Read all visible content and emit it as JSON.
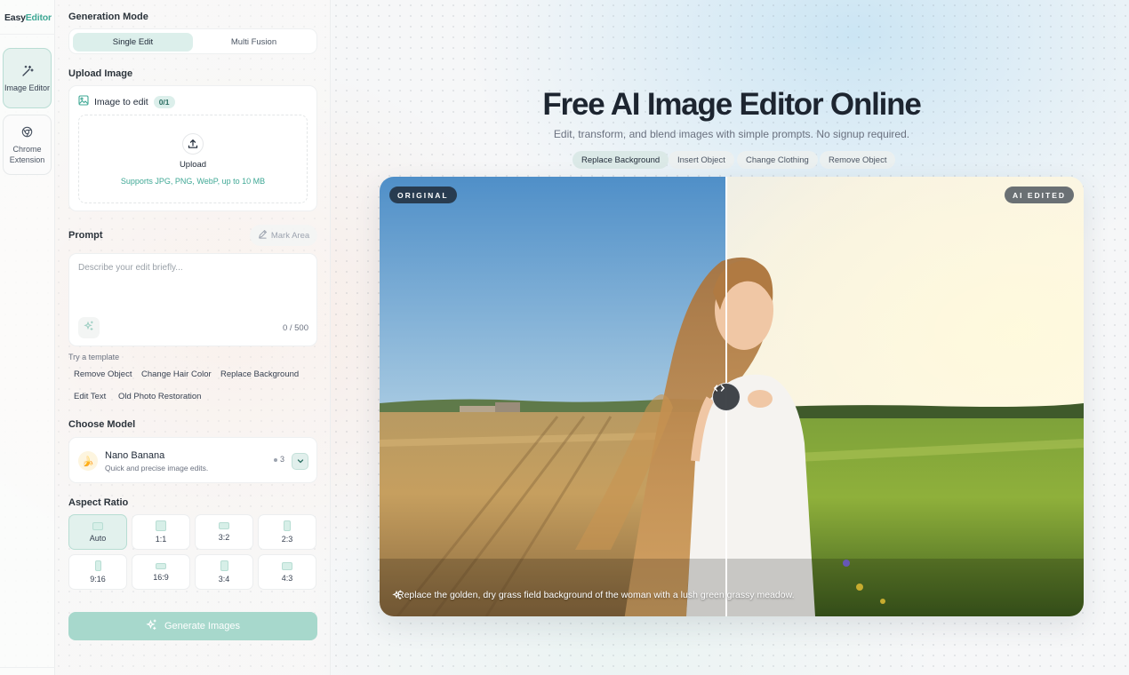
{
  "app": {
    "logo_main": "Easy",
    "logo_accent": "Editor"
  },
  "rail": {
    "items": [
      {
        "label": "Image Editor",
        "icon": "magic-wand-icon",
        "active": true
      },
      {
        "label": "Chrome Extension",
        "icon": "chrome-icon",
        "active": false
      }
    ]
  },
  "panel": {
    "generation_mode": {
      "title": "Generation Mode",
      "options": [
        "Single Edit",
        "Multi Fusion"
      ],
      "selected": "Single Edit"
    },
    "upload": {
      "title": "Upload Image",
      "field_label": "Image to edit",
      "count": "0/1",
      "button_label": "Upload",
      "hint": "Supports JPG, PNG, WebP, up to 10 MB"
    },
    "prompt": {
      "title": "Prompt",
      "mark_area_label": "Mark Area",
      "placeholder": "Describe your edit briefly...",
      "value": "",
      "counter": "0 / 500"
    },
    "templates": {
      "label": "Try a template",
      "items": [
        "Remove Object",
        "Change Hair Color",
        "Replace Background",
        "Edit Text",
        "Old Photo Restoration"
      ]
    },
    "model": {
      "title": "Choose Model",
      "name": "Nano Banana",
      "description": "Quick and precise image edits.",
      "credits": "3",
      "icon": "banana-icon"
    },
    "aspect_ratio": {
      "title": "Aspect Ratio",
      "options": [
        "Auto",
        "1:1",
        "3:2",
        "2:3",
        "9:16",
        "16:9",
        "3:4",
        "4:3"
      ],
      "selected": "Auto"
    },
    "generate_label": "Generate Images"
  },
  "main": {
    "title": "Free AI Image Editor Online",
    "subtitle": "Edit, transform, and blend images with simple prompts. No signup required.",
    "features": [
      "Replace Background",
      "Insert Object",
      "Change Clothing",
      "Remove Object"
    ],
    "active_feature": "Replace Background",
    "compare": {
      "left_badge": "ORIGINAL",
      "right_badge": "AI EDITED",
      "caption": "Replace the golden, dry grass field background of the woman with a lush green grassy meadow."
    }
  },
  "colors": {
    "accent": "#3fa895",
    "accent_soft": "#dcefeb",
    "generate_button": "#a7d8cc"
  }
}
